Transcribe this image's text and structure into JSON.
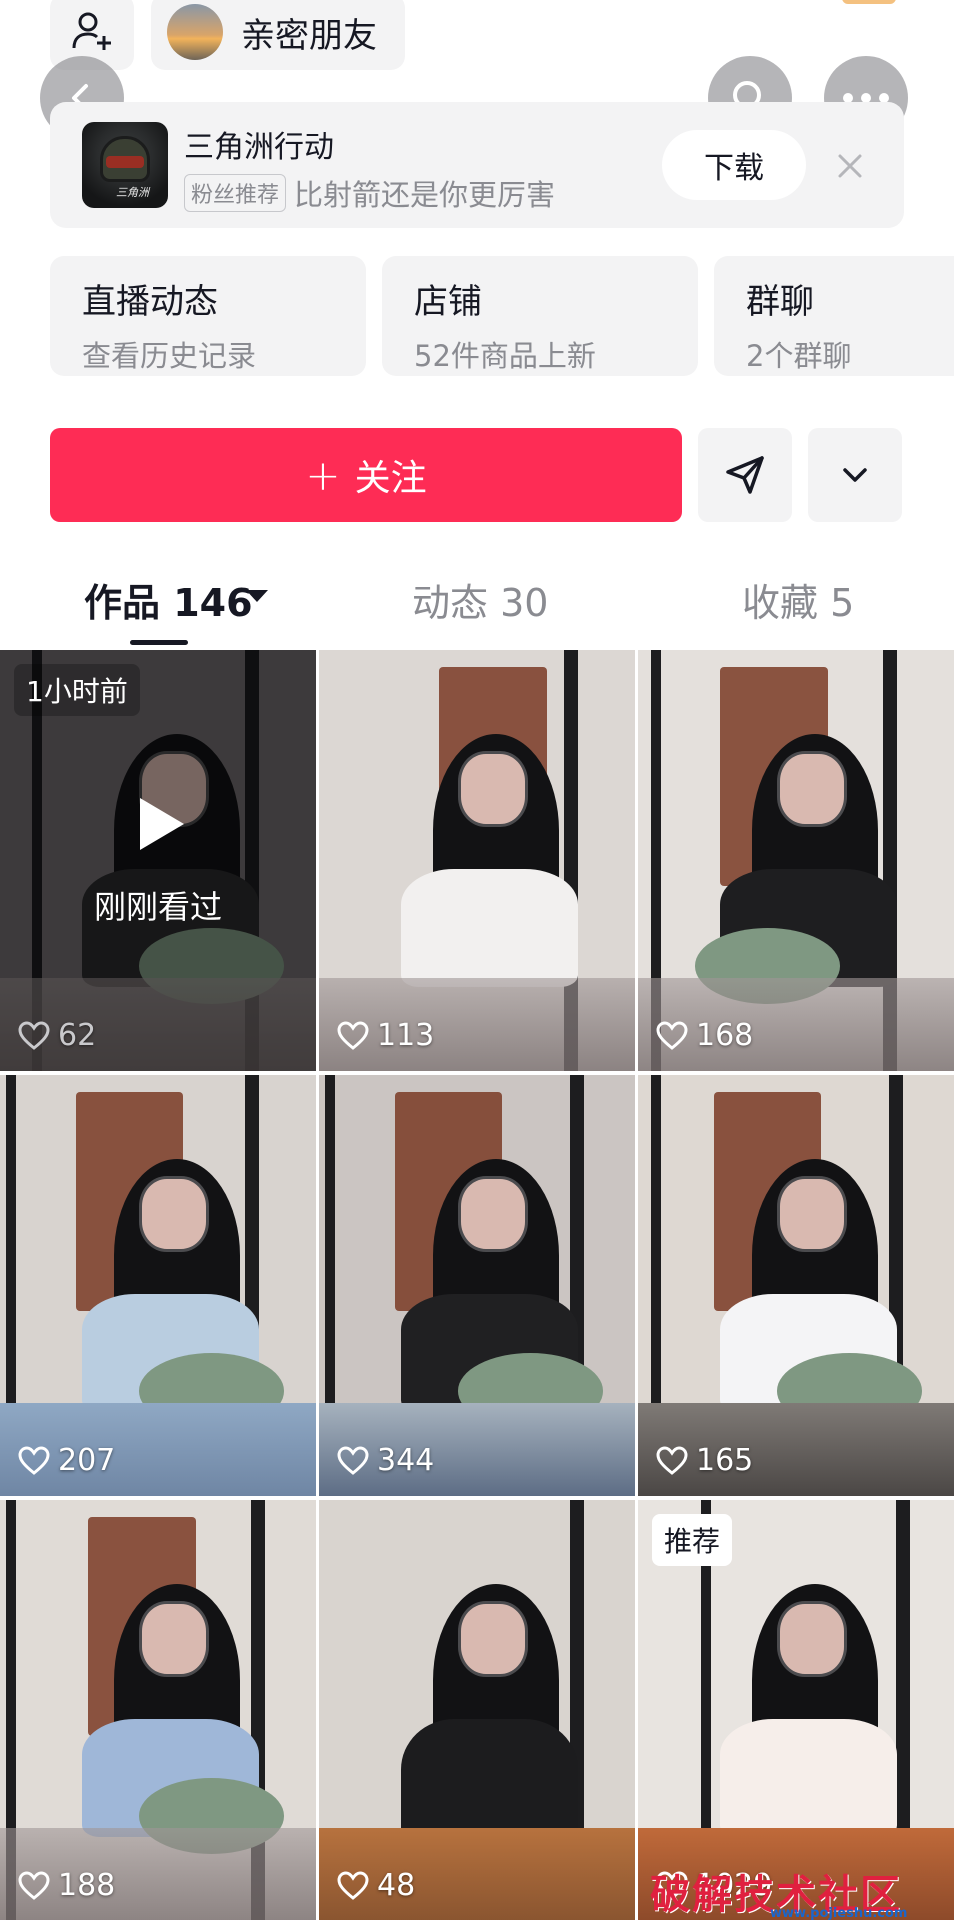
{
  "top_strip": {
    "close_friends_label": "亲密朋友"
  },
  "ad": {
    "title": "三角洲行动",
    "badge": "粉丝推荐",
    "description": "比射箭还是你更厉害",
    "download_label": "下载",
    "logo_text": "三角洲"
  },
  "info_cards": [
    {
      "title": "直播动态",
      "subtitle": "查看历史记录"
    },
    {
      "title": "店铺",
      "subtitle": "52件商品上新"
    },
    {
      "title": "群聊",
      "subtitle": "2个群聊"
    }
  ],
  "follow": {
    "plus": "+",
    "label": "关注"
  },
  "tabs": [
    {
      "label": "作品 146",
      "active": true
    },
    {
      "label": "动态 30",
      "active": false
    },
    {
      "label": "收藏 5",
      "active": false
    }
  ],
  "videos": [
    {
      "likes": "62",
      "tag": "1小时前",
      "overlay": "刚刚看过"
    },
    {
      "likes": "113"
    },
    {
      "likes": "168"
    },
    {
      "likes": "207"
    },
    {
      "likes": "344"
    },
    {
      "likes": "165"
    },
    {
      "likes": "188"
    },
    {
      "likes": "48"
    },
    {
      "likes": "1029",
      "tag": "推荐"
    }
  ],
  "watermark": {
    "text": "破解技术社区",
    "url": "www.pojieshu.com"
  },
  "colors": {
    "accent": "#fe2c55",
    "card_bg": "#f3f3f4",
    "secondary_text": "#8a8b91"
  }
}
